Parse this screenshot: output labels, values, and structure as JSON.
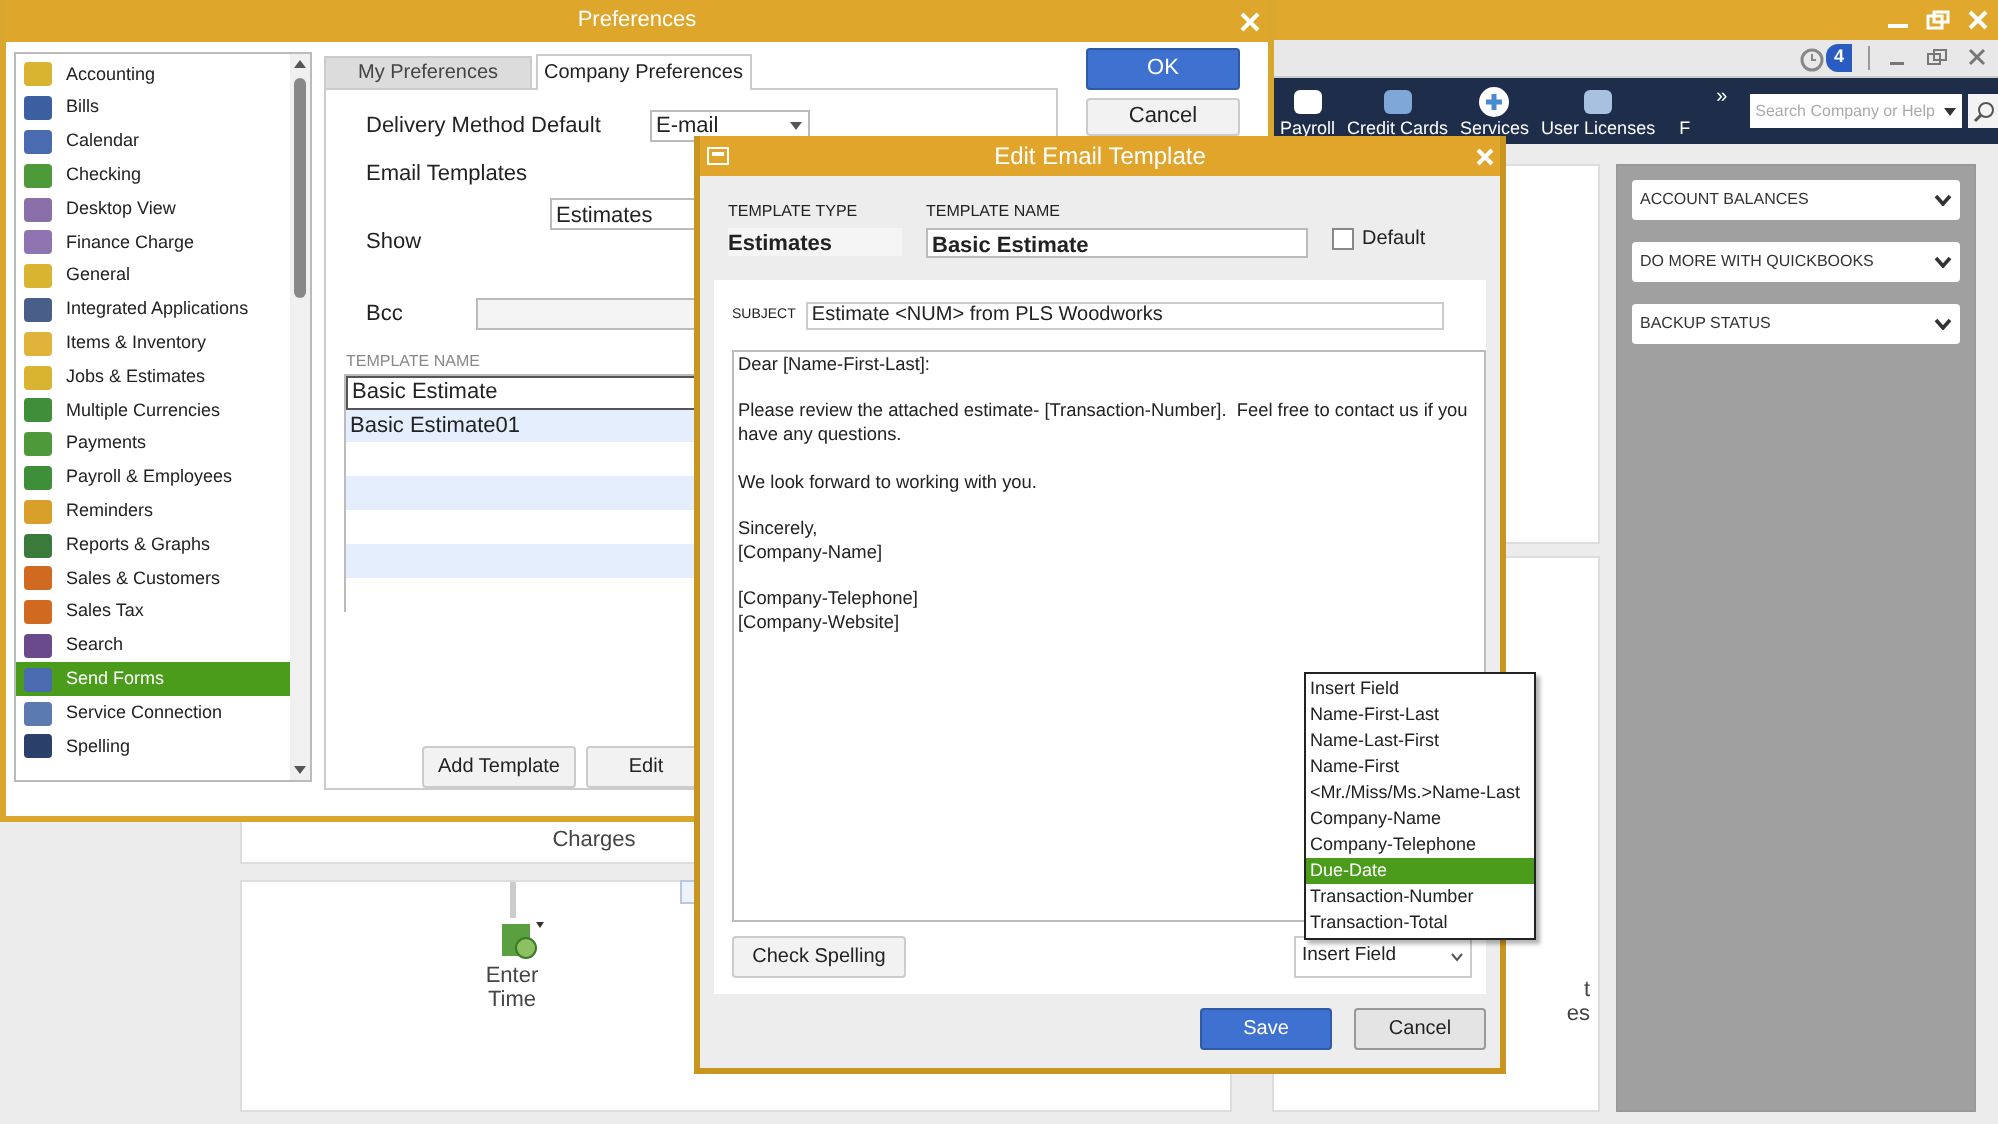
{
  "app": {
    "reminders_badge": "4",
    "toolbar": [
      {
        "label": "Payroll"
      },
      {
        "label": "Credit Cards"
      },
      {
        "label": "Services"
      },
      {
        "label": "User Licenses"
      },
      {
        "label": "F"
      }
    ],
    "more": "»",
    "search": {
      "placeholder": "Search Company or Help"
    },
    "side_panels": [
      {
        "label": "ACCOUNT BALANCES"
      },
      {
        "label": "DO MORE WITH QUICKBOOKS"
      },
      {
        "label": "BACKUP STATUS"
      }
    ],
    "workflow": {
      "statement": "Charges",
      "enter_time": "Enter\nTime",
      "fragment_1": "t",
      "fragment_2": "es"
    }
  },
  "preferences": {
    "title": "Preferences",
    "categories": [
      {
        "label": "Accounting",
        "selected": false
      },
      {
        "label": "Bills",
        "selected": false
      },
      {
        "label": "Calendar",
        "selected": false
      },
      {
        "label": "Checking",
        "selected": false
      },
      {
        "label": "Desktop View",
        "selected": false
      },
      {
        "label": "Finance Charge",
        "selected": false
      },
      {
        "label": "General",
        "selected": false
      },
      {
        "label": "Integrated Applications",
        "selected": false
      },
      {
        "label": "Items & Inventory",
        "selected": false
      },
      {
        "label": "Jobs & Estimates",
        "selected": false
      },
      {
        "label": "Multiple Currencies",
        "selected": false
      },
      {
        "label": "Payments",
        "selected": false
      },
      {
        "label": "Payroll & Employees",
        "selected": false
      },
      {
        "label": "Reminders",
        "selected": false
      },
      {
        "label": "Reports & Graphs",
        "selected": false
      },
      {
        "label": "Sales & Customers",
        "selected": false
      },
      {
        "label": "Sales Tax",
        "selected": false
      },
      {
        "label": "Search",
        "selected": false
      },
      {
        "label": "Send Forms",
        "selected": true
      },
      {
        "label": "Service Connection",
        "selected": false
      },
      {
        "label": "Spelling",
        "selected": false
      }
    ],
    "tabs": [
      {
        "label": "My Preferences",
        "selected": false
      },
      {
        "label": "Company Preferences",
        "selected": true
      }
    ],
    "delivery_method_label": "Delivery Method Default",
    "delivery_method": "E-mail",
    "email_templates_label": "Email Templates",
    "show_label": "Show",
    "show": "Estimates",
    "bcc_label": "Bcc",
    "template_column": "TEMPLATE NAME",
    "templates": [
      {
        "name": "Basic Estimate",
        "selected": true
      },
      {
        "name": "Basic Estimate01",
        "selected": false
      }
    ],
    "buttons": [
      "Add Template",
      "Edit"
    ],
    "ok": "OK",
    "cancel": "Cancel"
  },
  "edit_email_template": {
    "title": "Edit Email Template",
    "template_type_label": "TEMPLATE TYPE",
    "template_type": "Estimates",
    "template_name_label": "TEMPLATE NAME",
    "template_name": "Basic Estimate",
    "default": {
      "label": "Default",
      "checked": false
    },
    "subject_label": "SUBJECT",
    "subject": "Estimate <NUM> from PLS Woodworks",
    "body": "Dear [Name-First-Last]:\n\nPlease review the attached estimate- [Transaction-Number].  Feel free to contact us if you have any questions.\n\nWe look forward to working with you.\n\nSincerely,\n[Company-Name]\n\n[Company-Telephone]\n[Company-Website]",
    "check_spelling": "Check Spelling",
    "insert_field": "Insert Field",
    "insert_options": [
      {
        "label": "Insert Field",
        "selected": false
      },
      {
        "label": "Name-First-Last",
        "selected": false
      },
      {
        "label": "Name-Last-First",
        "selected": false
      },
      {
        "label": "Name-First",
        "selected": false
      },
      {
        "label": "<Mr./Miss/Ms.>Name-Last",
        "selected": false
      },
      {
        "label": "Company-Name",
        "selected": false
      },
      {
        "label": "Company-Telephone",
        "selected": false
      },
      {
        "label": "Due-Date",
        "selected": true
      },
      {
        "label": "Transaction-Number",
        "selected": false
      },
      {
        "label": "Transaction-Total",
        "selected": false
      }
    ],
    "save": "Save",
    "cancel": "Cancel"
  }
}
